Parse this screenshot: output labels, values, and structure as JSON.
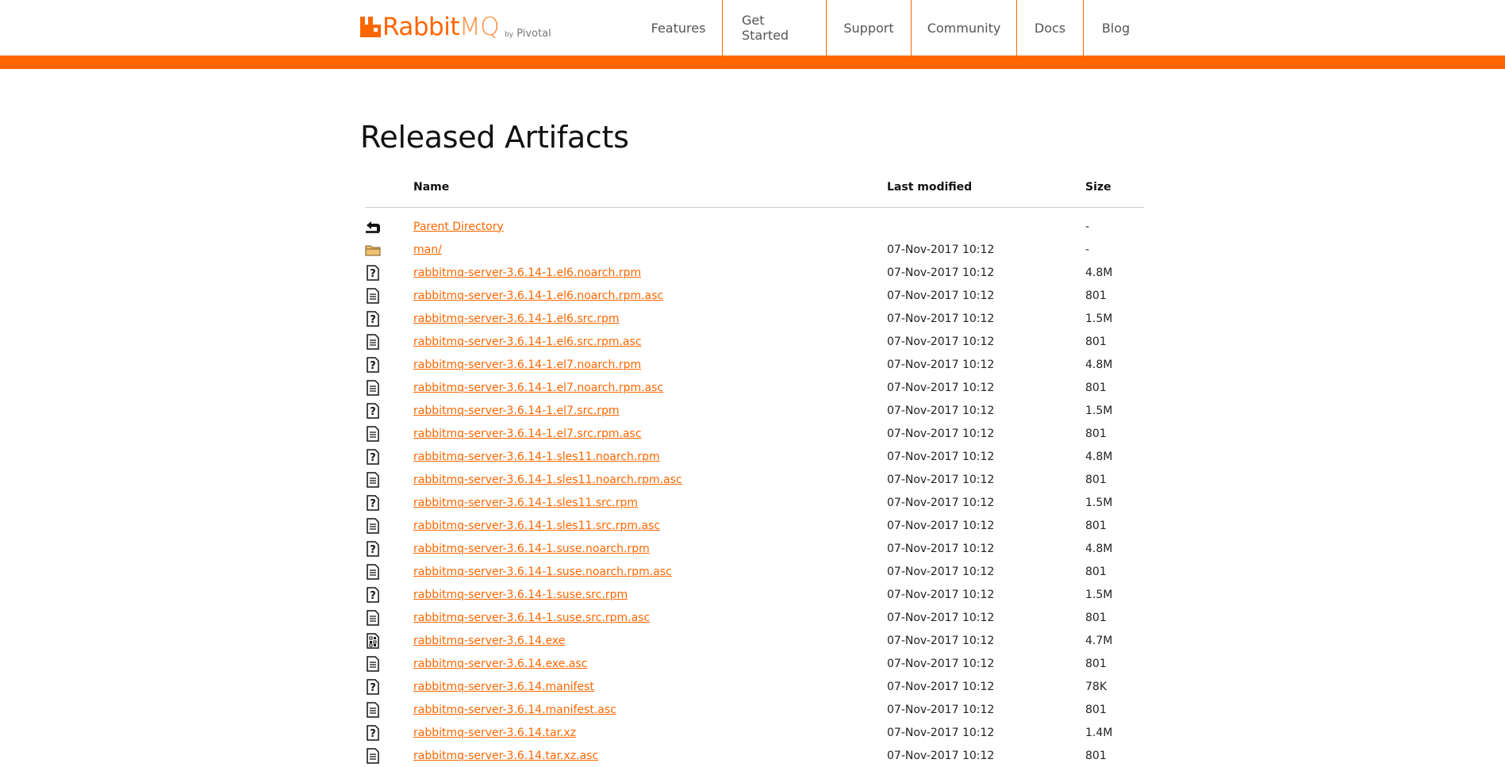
{
  "brand": {
    "name_rabbit": "Rabbit",
    "name_mq": "MQ",
    "by": "by",
    "vendor": "Pivotal",
    "accent_color": "#ff6600"
  },
  "nav": [
    {
      "label": "Features"
    },
    {
      "label": "Get Started"
    },
    {
      "label": "Support"
    },
    {
      "label": "Community"
    },
    {
      "label": "Docs"
    },
    {
      "label": "Blog"
    }
  ],
  "page_title": "Released Artifacts",
  "table": {
    "headers": {
      "name": "Name",
      "modified": "Last modified",
      "size": "Size"
    },
    "rows": [
      {
        "icon": "back-icon",
        "name": "Parent Directory",
        "modified": "",
        "size": "-"
      },
      {
        "icon": "folder-icon",
        "name": "man/",
        "modified": "07-Nov-2017 10:12",
        "size": "-"
      },
      {
        "icon": "unknown-file-icon",
        "name": "rabbitmq-server-3.6.14-1.el6.noarch.rpm",
        "modified": "07-Nov-2017 10:12",
        "size": "4.8M"
      },
      {
        "icon": "text-file-icon",
        "name": "rabbitmq-server-3.6.14-1.el6.noarch.rpm.asc",
        "modified": "07-Nov-2017 10:12",
        "size": "801"
      },
      {
        "icon": "unknown-file-icon",
        "name": "rabbitmq-server-3.6.14-1.el6.src.rpm",
        "modified": "07-Nov-2017 10:12",
        "size": "1.5M"
      },
      {
        "icon": "text-file-icon",
        "name": "rabbitmq-server-3.6.14-1.el6.src.rpm.asc",
        "modified": "07-Nov-2017 10:12",
        "size": "801"
      },
      {
        "icon": "unknown-file-icon",
        "name": "rabbitmq-server-3.6.14-1.el7.noarch.rpm",
        "modified": "07-Nov-2017 10:12",
        "size": "4.8M"
      },
      {
        "icon": "text-file-icon",
        "name": "rabbitmq-server-3.6.14-1.el7.noarch.rpm.asc",
        "modified": "07-Nov-2017 10:12",
        "size": "801"
      },
      {
        "icon": "unknown-file-icon",
        "name": "rabbitmq-server-3.6.14-1.el7.src.rpm",
        "modified": "07-Nov-2017 10:12",
        "size": "1.5M"
      },
      {
        "icon": "text-file-icon",
        "name": "rabbitmq-server-3.6.14-1.el7.src.rpm.asc",
        "modified": "07-Nov-2017 10:12",
        "size": "801"
      },
      {
        "icon": "unknown-file-icon",
        "name": "rabbitmq-server-3.6.14-1.sles11.noarch.rpm",
        "modified": "07-Nov-2017 10:12",
        "size": "4.8M"
      },
      {
        "icon": "text-file-icon",
        "name": "rabbitmq-server-3.6.14-1.sles11.noarch.rpm.asc",
        "modified": "07-Nov-2017 10:12",
        "size": "801"
      },
      {
        "icon": "unknown-file-icon",
        "name": "rabbitmq-server-3.6.14-1.sles11.src.rpm",
        "modified": "07-Nov-2017 10:12",
        "size": "1.5M"
      },
      {
        "icon": "text-file-icon",
        "name": "rabbitmq-server-3.6.14-1.sles11.src.rpm.asc",
        "modified": "07-Nov-2017 10:12",
        "size": "801"
      },
      {
        "icon": "unknown-file-icon",
        "name": "rabbitmq-server-3.6.14-1.suse.noarch.rpm",
        "modified": "07-Nov-2017 10:12",
        "size": "4.8M"
      },
      {
        "icon": "text-file-icon",
        "name": "rabbitmq-server-3.6.14-1.suse.noarch.rpm.asc",
        "modified": "07-Nov-2017 10:12",
        "size": "801"
      },
      {
        "icon": "unknown-file-icon",
        "name": "rabbitmq-server-3.6.14-1.suse.src.rpm",
        "modified": "07-Nov-2017 10:12",
        "size": "1.5M"
      },
      {
        "icon": "text-file-icon",
        "name": "rabbitmq-server-3.6.14-1.suse.src.rpm.asc",
        "modified": "07-Nov-2017 10:12",
        "size": "801"
      },
      {
        "icon": "binary-file-icon",
        "name": "rabbitmq-server-3.6.14.exe",
        "modified": "07-Nov-2017 10:12",
        "size": "4.7M"
      },
      {
        "icon": "text-file-icon",
        "name": "rabbitmq-server-3.6.14.exe.asc",
        "modified": "07-Nov-2017 10:12",
        "size": "801"
      },
      {
        "icon": "unknown-file-icon",
        "name": "rabbitmq-server-3.6.14.manifest",
        "modified": "07-Nov-2017 10:12",
        "size": "78K"
      },
      {
        "icon": "text-file-icon",
        "name": "rabbitmq-server-3.6.14.manifest.asc",
        "modified": "07-Nov-2017 10:12",
        "size": "801"
      },
      {
        "icon": "unknown-file-icon",
        "name": "rabbitmq-server-3.6.14.tar.xz",
        "modified": "07-Nov-2017 10:12",
        "size": "1.4M"
      },
      {
        "icon": "text-file-icon",
        "name": "rabbitmq-server-3.6.14.tar.xz.asc",
        "modified": "07-Nov-2017 10:12",
        "size": "801"
      }
    ]
  }
}
